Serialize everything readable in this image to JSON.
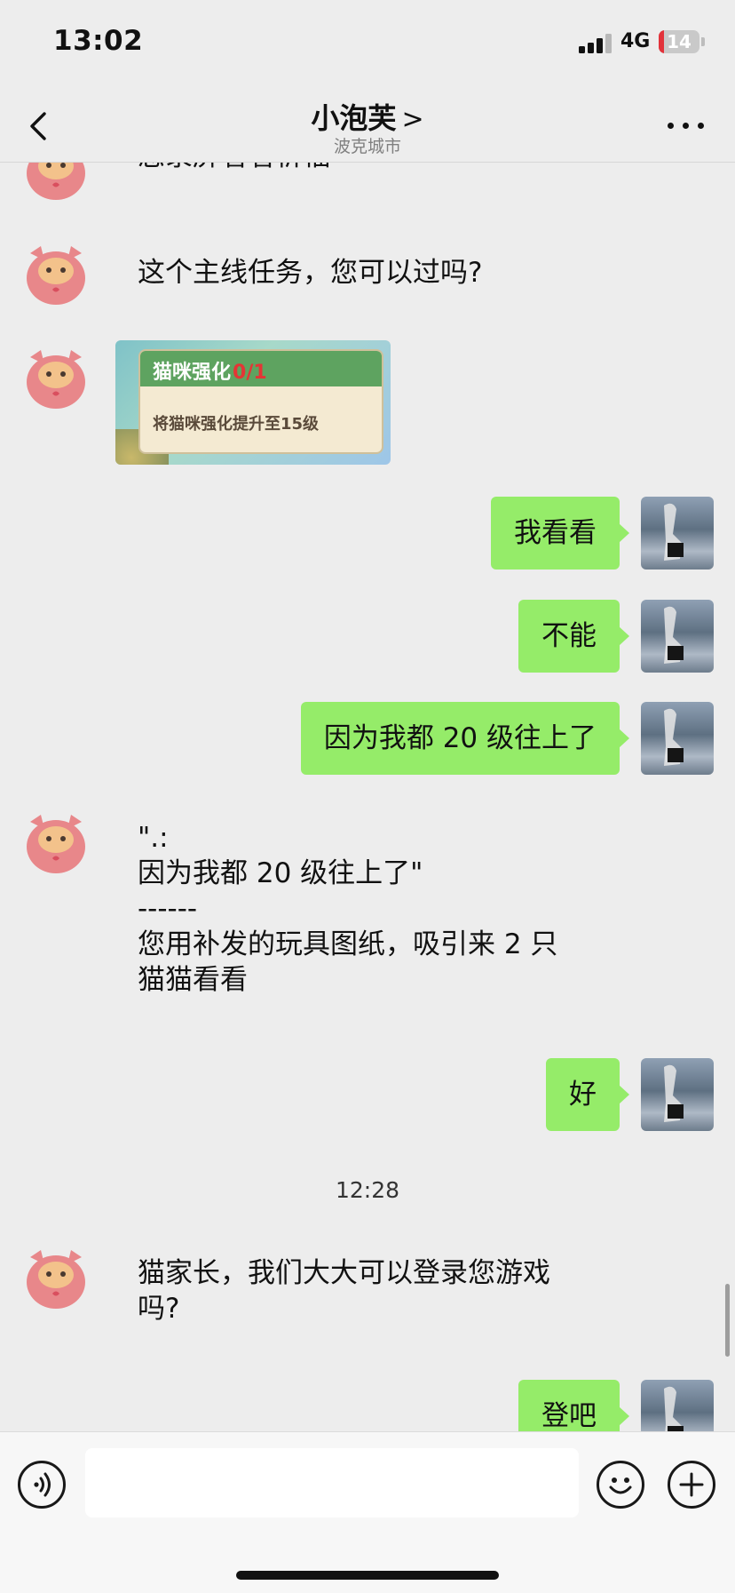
{
  "status_bar": {
    "time": "13:02",
    "network": "4G",
    "battery_level": "14",
    "battery_fraction": 0.14
  },
  "header": {
    "title": "小泡芙",
    "chevron": ">",
    "subtitle": "波克城市"
  },
  "messages": [
    {
      "id": "m0",
      "side": "received",
      "text": "您录屏看看祈福"
    },
    {
      "id": "m1",
      "side": "received",
      "text": "这个主线任务，您可以过吗?"
    },
    {
      "id": "m2",
      "side": "received",
      "type": "image",
      "image": {
        "title": "猫咪强化",
        "count": "0/1",
        "desc": "将猫咪强化提升至15级"
      }
    },
    {
      "id": "m3",
      "side": "sent",
      "text": "我看看"
    },
    {
      "id": "m4",
      "side": "sent",
      "text": "不能"
    },
    {
      "id": "m5",
      "side": "sent",
      "text": "因为我都 20 级往上了"
    },
    {
      "id": "m6",
      "side": "received",
      "lines": [
        "\".:",
        "因为我都 20 级往上了\"",
        "------",
        "您用补发的玩具图纸，吸引来 2 只",
        "猫猫看看"
      ]
    },
    {
      "id": "m7",
      "side": "sent",
      "text": "好"
    },
    {
      "id": "m8",
      "side": "received",
      "lines": [
        "猫家长，我们大大可以登录您游戏",
        "吗?"
      ]
    },
    {
      "id": "m9",
      "side": "sent",
      "text": "登吧"
    }
  ],
  "timestamp": "12:28",
  "input": {
    "placeholder": ""
  },
  "icons": {
    "back": "chevron-left-icon",
    "more": "more-horizontal-icon",
    "voice": "voice-icon",
    "emoji": "emoji-icon",
    "plus": "plus-icon"
  },
  "colors": {
    "sent_bubble": "#95ec69",
    "background": "#ededed",
    "received_avatar": "#e8878a"
  }
}
